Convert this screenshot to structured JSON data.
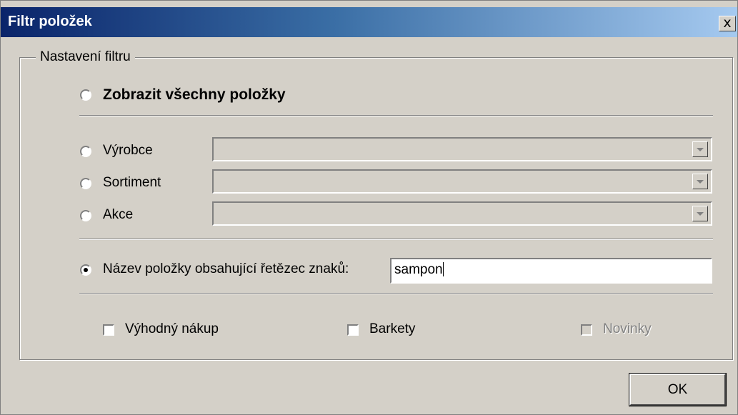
{
  "window": {
    "title": "Filtr položek",
    "close_label": "x"
  },
  "group": {
    "legend": "Nastavení filtru"
  },
  "options": {
    "show_all": {
      "label": "Zobrazit všechny položky",
      "selected": false
    },
    "manufacturer": {
      "label": "Výrobce",
      "selected": false,
      "value": ""
    },
    "assortment": {
      "label": "Sortiment",
      "selected": false,
      "value": ""
    },
    "promotion": {
      "label": "Akce",
      "selected": false,
      "value": ""
    },
    "name_contains": {
      "label": "Název položky obsahující řetězec znaků:",
      "selected": true,
      "value": "sampon"
    }
  },
  "checkboxes": {
    "bargain": {
      "label": "Výhodný nákup",
      "checked": false,
      "enabled": true
    },
    "barkety": {
      "label": "Barkety",
      "checked": false,
      "enabled": true
    },
    "new_items": {
      "label": "Novinky",
      "checked": false,
      "enabled": false
    }
  },
  "buttons": {
    "ok": "OK"
  },
  "colors": {
    "face": "#d4d0c8",
    "title_start": "#0a246a",
    "title_end": "#a6caf0"
  }
}
